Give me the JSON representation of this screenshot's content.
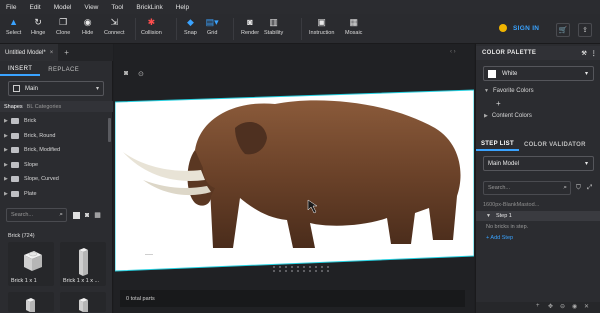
{
  "menu": [
    "File",
    "Edit",
    "Model",
    "View",
    "Tool",
    "BrickLink",
    "Help"
  ],
  "toolbar": {
    "select": "Select",
    "hinge": "Hinge",
    "clone": "Clone",
    "hide": "Hide",
    "connect": "Connect",
    "collision": "Collision",
    "snap": "Snap",
    "grid": "Grid",
    "render": "Render",
    "stability": "Stability",
    "instruction": "Instruction",
    "mosaic": "Mosaic"
  },
  "account": {
    "sign_in": "SIGN IN"
  },
  "model_tab": {
    "title": "Untitled Model*",
    "close": "×",
    "add": "+"
  },
  "left": {
    "tabs": [
      "INSERT",
      "REPLACE"
    ],
    "palette_select": "Main",
    "shapes_title": "Shapes",
    "shapes_sub": "BL Categories",
    "shapes": [
      "Brick",
      "Brick, Round",
      "Brick, Modified",
      "Slope",
      "Slope, Curved",
      "Plate"
    ],
    "search_placeholder": "Search...",
    "brick_count": "Brick (724)",
    "bricks": [
      "Brick 1 x 1",
      "Brick 1 x 1 x ..."
    ]
  },
  "canvas": {
    "status": "0 total parts",
    "image_caption": "1600px-BlankMastod..."
  },
  "right": {
    "color_palette": "COLOR PALETTE",
    "color_select": "White",
    "favorite_colors": "Favorite Colors",
    "add": "+",
    "content_colors": "Content Colors",
    "tabs": [
      "STEP LIST",
      "COLOR VALIDATOR"
    ],
    "model_select": "Main Model",
    "search_placeholder": "Search...",
    "filename": "1600px-BlankMastod...",
    "step_1": "Step 1",
    "no_bricks": "No bricks in step.",
    "add_step": "+ Add Step"
  },
  "colors": {
    "accent": "#3aa3ff",
    "panel": "#2b2c30",
    "canvas": "#202124",
    "collision": "#ff4e4e",
    "coin": "#f0b400"
  }
}
